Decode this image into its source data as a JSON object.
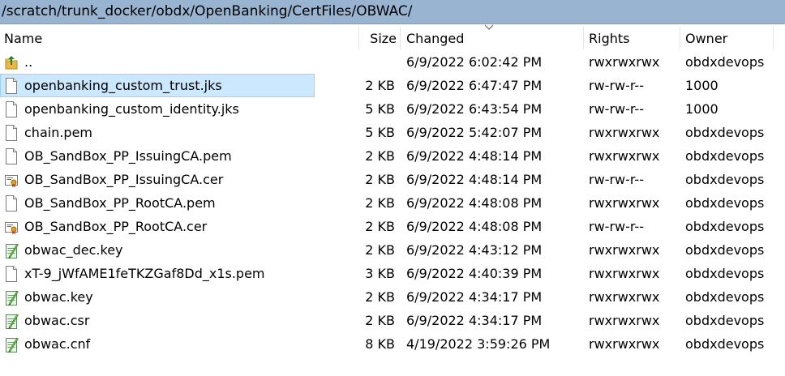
{
  "path": "/scratch/trunk_docker/obdx/OpenBanking/CertFiles/OBWAC/",
  "columns": {
    "name": "Name",
    "size": "Size",
    "changed": "Changed",
    "rights": "Rights",
    "owner": "Owner"
  },
  "sort": {
    "column": "Changed",
    "direction": "descending"
  },
  "colors": {
    "pathbar": "#99b4d1",
    "selection": "#cce8ff",
    "selection_border": "#99d1ff"
  },
  "files": [
    {
      "name": "..",
      "icon": "parent-folder-icon",
      "size": "",
      "changed": "6/9/2022 6:02:42 PM",
      "rights": "rwxrwxrwx",
      "owner": "obdxdevops",
      "selected": false
    },
    {
      "name": "openbanking_custom_trust.jks",
      "icon": "file-icon",
      "size": "2 KB",
      "changed": "6/9/2022 6:47:47 PM",
      "rights": "rw-rw-r--",
      "owner": "1000",
      "selected": true
    },
    {
      "name": "openbanking_custom_identity.jks",
      "icon": "file-icon",
      "size": "5 KB",
      "changed": "6/9/2022 6:43:54 PM",
      "rights": "rw-rw-r--",
      "owner": "1000",
      "selected": false
    },
    {
      "name": "chain.pem",
      "icon": "file-icon",
      "size": "5 KB",
      "changed": "6/9/2022 5:42:07 PM",
      "rights": "rwxrwxrwx",
      "owner": "obdxdevops",
      "selected": false
    },
    {
      "name": "OB_SandBox_PP_IssuingCA.pem",
      "icon": "file-icon",
      "size": "2 KB",
      "changed": "6/9/2022 4:48:14 PM",
      "rights": "rwxrwxrwx",
      "owner": "obdxdevops",
      "selected": false
    },
    {
      "name": "OB_SandBox_PP_IssuingCA.cer",
      "icon": "certificate-icon",
      "size": "2 KB",
      "changed": "6/9/2022 4:48:14 PM",
      "rights": "rw-rw-r--",
      "owner": "obdxdevops",
      "selected": false
    },
    {
      "name": "OB_SandBox_PP_RootCA.pem",
      "icon": "file-icon",
      "size": "2 KB",
      "changed": "6/9/2022 4:48:08 PM",
      "rights": "rwxrwxrwx",
      "owner": "obdxdevops",
      "selected": false
    },
    {
      "name": "OB_SandBox_PP_RootCA.cer",
      "icon": "certificate-icon",
      "size": "2 KB",
      "changed": "6/9/2022 4:48:08 PM",
      "rights": "rw-rw-r--",
      "owner": "obdxdevops",
      "selected": false
    },
    {
      "name": "obwac_dec.key",
      "icon": "notepad-icon",
      "size": "2 KB",
      "changed": "6/9/2022 4:43:12 PM",
      "rights": "rwxrwxrwx",
      "owner": "obdxdevops",
      "selected": false
    },
    {
      "name": "xT-9_jWfAME1feTKZGaf8Dd_x1s.pem",
      "icon": "file-icon",
      "size": "3 KB",
      "changed": "6/9/2022 4:40:39 PM",
      "rights": "rwxrwxrwx",
      "owner": "obdxdevops",
      "selected": false
    },
    {
      "name": "obwac.key",
      "icon": "notepad-icon",
      "size": "2 KB",
      "changed": "6/9/2022 4:34:17 PM",
      "rights": "rwxrwxrwx",
      "owner": "obdxdevops",
      "selected": false
    },
    {
      "name": "obwac.csr",
      "icon": "notepad-icon",
      "size": "2 KB",
      "changed": "6/9/2022 4:34:17 PM",
      "rights": "rwxrwxrwx",
      "owner": "obdxdevops",
      "selected": false
    },
    {
      "name": "obwac.cnf",
      "icon": "notepad-icon",
      "size": "8 KB",
      "changed": "4/19/2022 3:59:26 PM",
      "rights": "rwxrwxrwx",
      "owner": "obdxdevops",
      "selected": false
    }
  ]
}
